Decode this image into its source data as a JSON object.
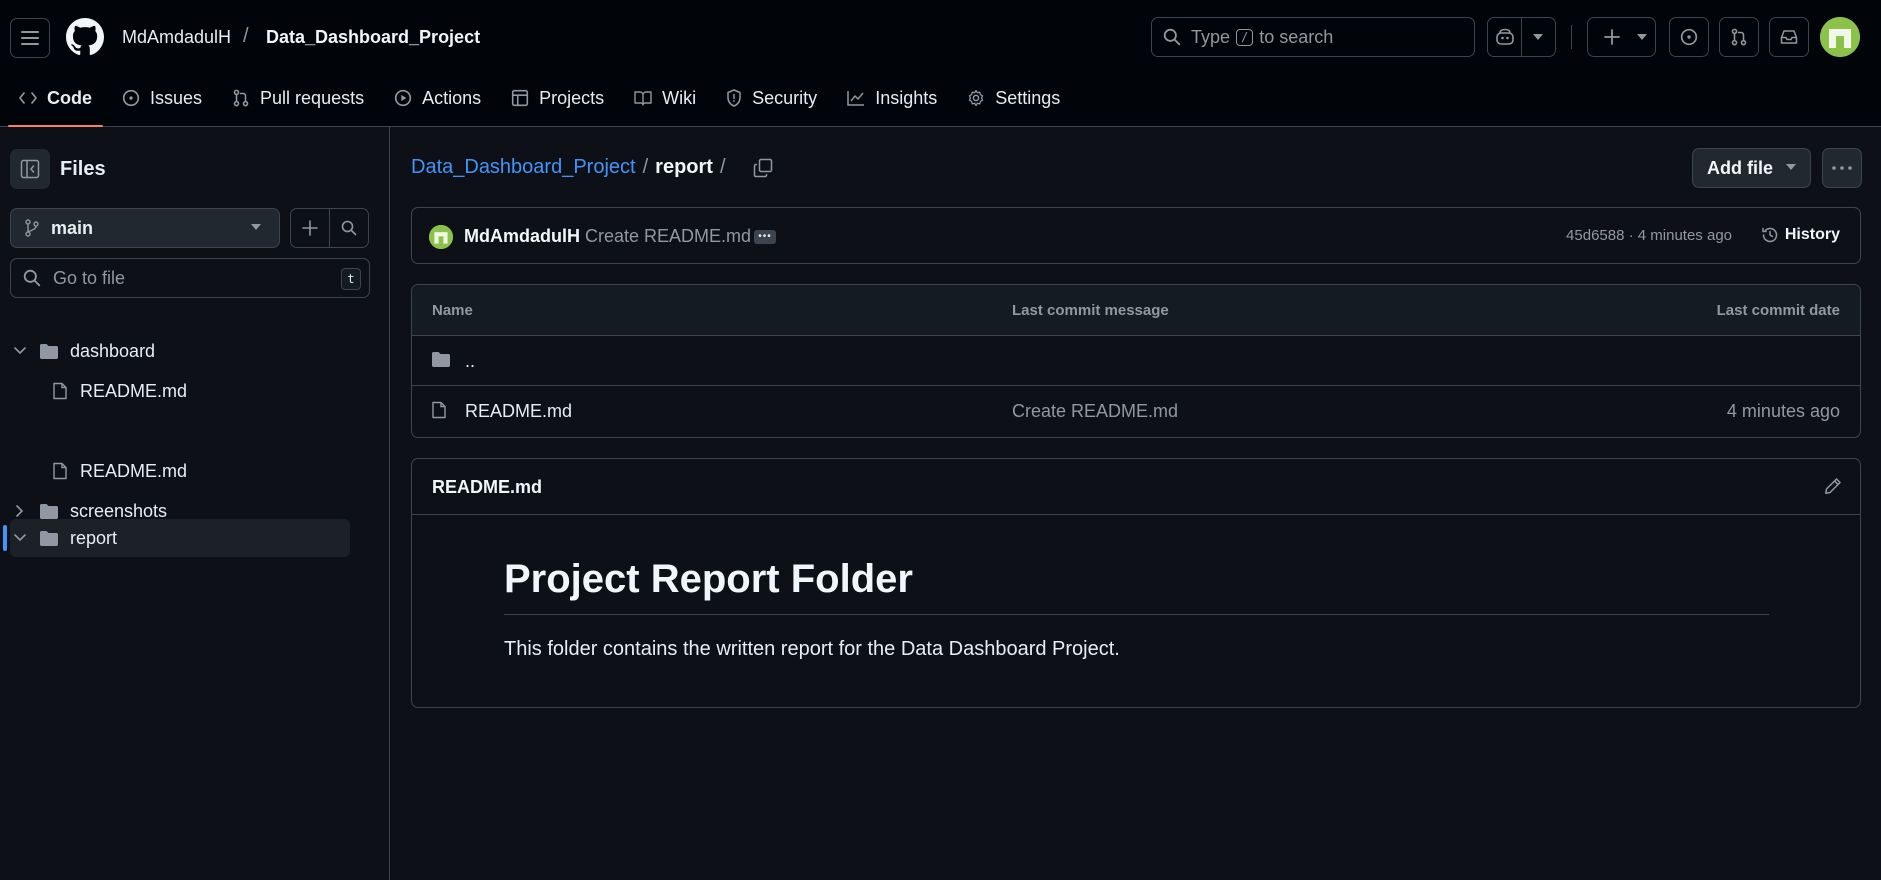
{
  "header": {
    "owner": "MdAmdadulH",
    "separator": "/",
    "repo": "Data_Dashboard_Project",
    "search_prefix": "Type",
    "search_key": "/",
    "search_suffix": "to search"
  },
  "tabs": [
    {
      "label": "Code",
      "icon": "code-icon"
    },
    {
      "label": "Issues",
      "icon": "issue-icon"
    },
    {
      "label": "Pull requests",
      "icon": "pull-request-icon"
    },
    {
      "label": "Actions",
      "icon": "play-icon"
    },
    {
      "label": "Projects",
      "icon": "table-icon"
    },
    {
      "label": "Wiki",
      "icon": "book-icon"
    },
    {
      "label": "Security",
      "icon": "shield-icon"
    },
    {
      "label": "Insights",
      "icon": "graph-icon"
    },
    {
      "label": "Settings",
      "icon": "gear-icon"
    }
  ],
  "sidebar": {
    "title": "Files",
    "branch": "main",
    "goto_placeholder": "Go to file",
    "goto_key": "t",
    "tree": [
      {
        "label": "dashboard",
        "type": "folder",
        "expanded": true
      },
      {
        "label": "README.md",
        "type": "file"
      },
      {
        "label": "report",
        "type": "folder",
        "expanded": true,
        "selected": true
      },
      {
        "label": "README.md",
        "type": "file"
      },
      {
        "label": "screenshots",
        "type": "folder",
        "expanded": false
      }
    ]
  },
  "breadcrumb": {
    "repo": "Data_Dashboard_Project",
    "sep": "/",
    "current": "report",
    "trailing": "/"
  },
  "actions": {
    "add_file": "Add file"
  },
  "commit": {
    "author": "MdAmdadulH",
    "message": "Create README.md",
    "sha_time": "45d6588 · 4 minutes ago",
    "history": "History"
  },
  "table": {
    "headers": {
      "name": "Name",
      "message": "Last commit message",
      "date": "Last commit date"
    },
    "rows": [
      {
        "name": "..",
        "message": "",
        "date": "",
        "type": "folder"
      },
      {
        "name": "README.md",
        "message": "Create README.md",
        "date": "4 minutes ago",
        "type": "file"
      }
    ]
  },
  "readme": {
    "filename": "README.md",
    "heading": "Project Report Folder",
    "paragraph": "This folder contains the written report for the Data Dashboard Project."
  },
  "colors": {
    "background": "#0d1117",
    "header_bg": "#010409",
    "border": "#3d444d",
    "link": "#4493f8",
    "tab_underline": "#f78166",
    "avatar": "#8bc34a"
  }
}
